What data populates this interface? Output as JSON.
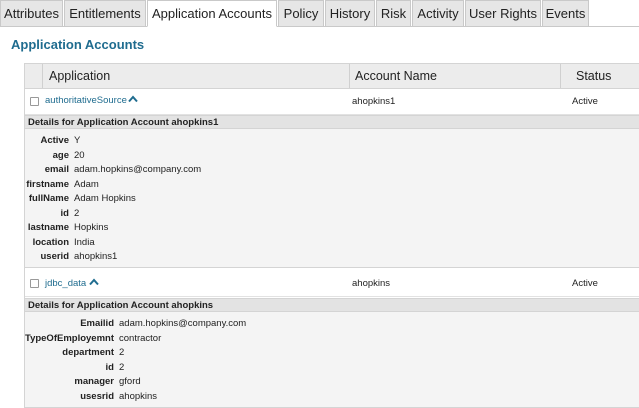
{
  "tabs": [
    {
      "label": "Attributes",
      "active": false
    },
    {
      "label": "Entitlements",
      "active": false
    },
    {
      "label": "Application Accounts",
      "active": true
    },
    {
      "label": "Policy",
      "active": false
    },
    {
      "label": "History",
      "active": false
    },
    {
      "label": "Risk",
      "active": false
    },
    {
      "label": "Activity",
      "active": false
    },
    {
      "label": "User Rights",
      "active": false
    },
    {
      "label": "Events",
      "active": false
    }
  ],
  "page_title": "Application Accounts",
  "table": {
    "columns": {
      "application": "Application",
      "account_name": "Account Name",
      "status": "Status"
    },
    "accounts": [
      {
        "application": "authoritativeSource",
        "account_name": "ahopkins1",
        "status": "Active",
        "expanded_icon": "chevron-up-icon",
        "details_title": "Details for Application Account ahopkins1",
        "details": [
          {
            "key": "Active",
            "value": "Y"
          },
          {
            "key": "age",
            "value": "20"
          },
          {
            "key": "email",
            "value": "adam.hopkins@company.com"
          },
          {
            "key": "firstname",
            "value": "Adam"
          },
          {
            "key": "fullName",
            "value": "Adam Hopkins"
          },
          {
            "key": "id",
            "value": "2"
          },
          {
            "key": "lastname",
            "value": "Hopkins"
          },
          {
            "key": "location",
            "value": "India"
          },
          {
            "key": "userid",
            "value": "ahopkins1"
          }
        ]
      },
      {
        "application": "jdbc_data",
        "account_name": "ahopkins",
        "status": "Active",
        "expanded_icon": "chevron-up-icon",
        "details_title": "Details for Application Account ahopkins",
        "details": [
          {
            "key": "Emailid",
            "value": "adam.hopkins@company.com"
          },
          {
            "key": "TypeOfEmployemnt",
            "value": "contractor"
          },
          {
            "key": "department",
            "value": "2"
          },
          {
            "key": "id",
            "value": "2"
          },
          {
            "key": "manager",
            "value": "gford"
          },
          {
            "key": "usesrid",
            "value": "ahopkins"
          }
        ]
      }
    ]
  },
  "colors": {
    "accent": "#1f6c8f",
    "tab_bg": "#e6e6e6",
    "header_bg": "#ececec",
    "details_bg": "#f4f4f4"
  }
}
